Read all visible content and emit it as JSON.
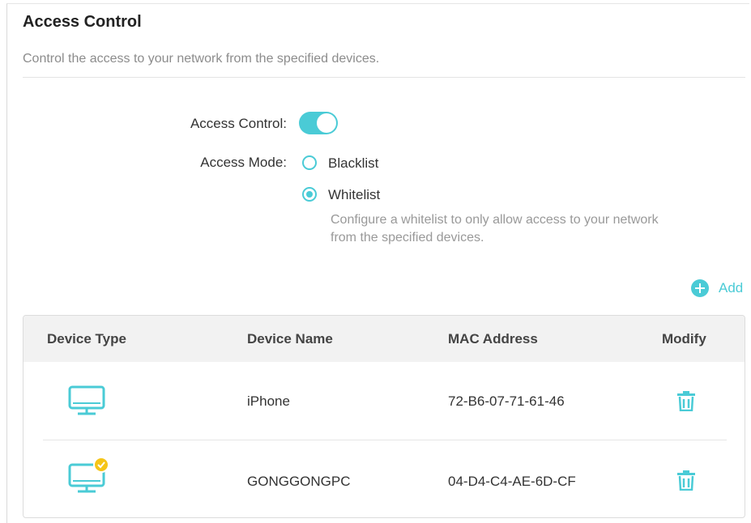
{
  "header": {
    "title": "Access Control",
    "subtitle": "Control the access to your network from the specified devices."
  },
  "settings": {
    "access_control_label": "Access Control:",
    "access_control_enabled": true,
    "access_mode_label": "Access Mode:",
    "modes": [
      {
        "label": "Blacklist",
        "selected": false
      },
      {
        "label": "Whitelist",
        "selected": true
      }
    ],
    "hint_line1": "Configure a whitelist to only allow access to your network",
    "hint_line2": "from the specified devices."
  },
  "actions": {
    "add_label": "Add"
  },
  "table": {
    "columns": [
      "Device Type",
      "Device Name",
      "MAC Address",
      "Modify"
    ],
    "rows": [
      {
        "device_type": "computer-icon",
        "name": "iPhone",
        "mac": "72-B6-07-71-61-46"
      },
      {
        "device_type": "computer-online-icon",
        "name": "GONGGONGPC",
        "mac": "04-D4-C4-AE-6D-CF"
      }
    ]
  },
  "colors": {
    "accent": "#4acbd6",
    "badge": "#f5c518"
  }
}
